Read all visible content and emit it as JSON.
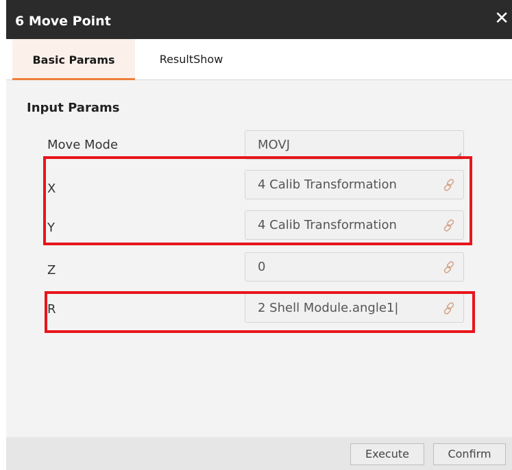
{
  "dialog": {
    "title": "6 Move Point",
    "close_icon": "close-icon"
  },
  "tabs": [
    {
      "label": "Basic Params",
      "active": true
    },
    {
      "label": "ResultShow",
      "active": false
    }
  ],
  "section_title": "Input Params",
  "params": [
    {
      "label": "Move Mode",
      "value": "MOVJ",
      "type": "select"
    },
    {
      "label": "X",
      "value": "4 Calib Transformation",
      "icon": "link-icon"
    },
    {
      "label": "Y",
      "value": "4 Calib Transformation",
      "icon": "link-icon"
    },
    {
      "label": "Z",
      "value": "0",
      "icon": "link-icon"
    },
    {
      "label": "R",
      "value": "2 Shell Module.angle1|",
      "icon": "link-icon"
    }
  ],
  "buttons": {
    "execute": "Execute",
    "confirm": "Confirm"
  },
  "colors": {
    "title_bar": "#2b2b2b",
    "tab_accent": "#ee7f3a",
    "highlight": "#e8141b"
  }
}
